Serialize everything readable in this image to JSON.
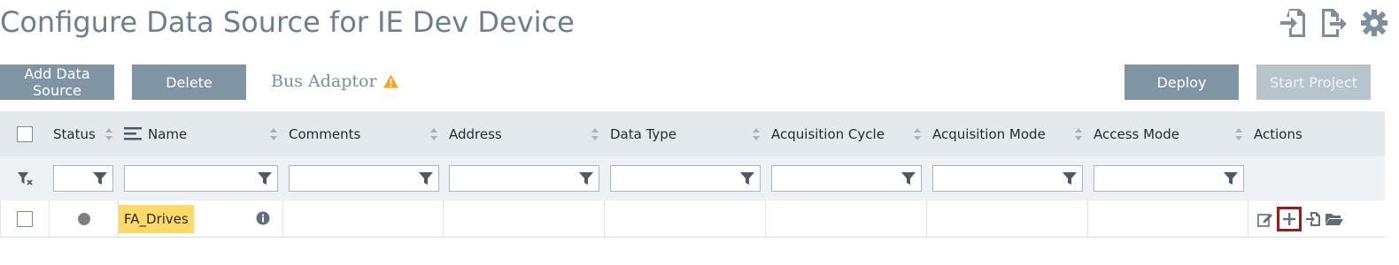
{
  "page": {
    "title": "Configure Data Source for IE Dev Device"
  },
  "toolbar": {
    "add_label": "Add Data Source",
    "delete_label": "Delete",
    "adaptor_label": "Bus Adaptor",
    "deploy_label": "Deploy",
    "start_label": "Start Project"
  },
  "top_icons": [
    "import-icon",
    "export-icon",
    "gear-icon"
  ],
  "table": {
    "headers": {
      "status": "Status",
      "name": "Name",
      "comments": "Comments",
      "address": "Address",
      "data_type": "Data Type",
      "acquisition_cycle": "Acquisition Cycle",
      "acquisition_mode": "Acquisition Mode",
      "access_mode": "Access Mode",
      "actions": "Actions"
    },
    "rows": [
      {
        "name": "FA_Drives",
        "comments": "",
        "address": "",
        "data_type": "",
        "acquisition_cycle": "",
        "acquisition_mode": "",
        "access_mode": "",
        "status_color": "#808080"
      }
    ]
  },
  "colors": {
    "button": "#7f95a3",
    "button_disabled": "#b7c4cc",
    "highlight": "#ffd966",
    "warning": "#f5a623",
    "selection_outline": "#9b1c1c"
  }
}
